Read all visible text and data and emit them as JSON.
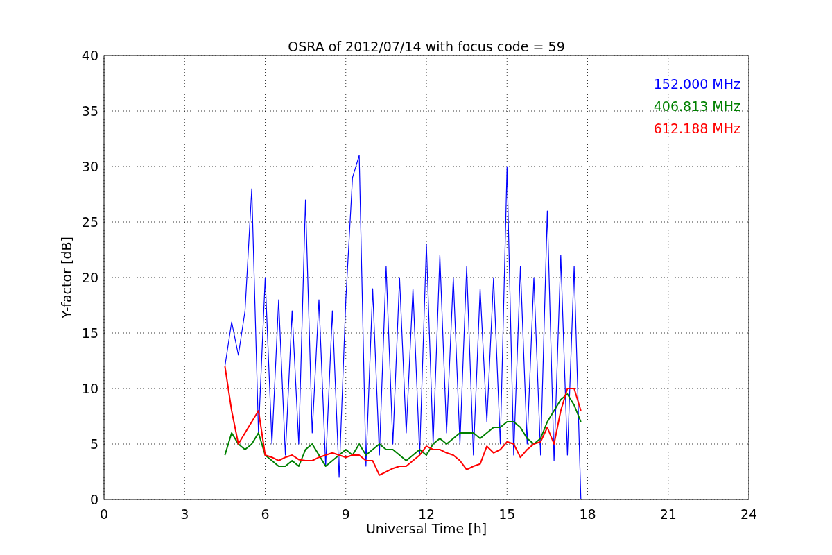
{
  "chart_data": {
    "type": "line",
    "title": "OSRA of 2012/07/14 with focus code = 59",
    "xlabel": "Universal Time [h]",
    "ylabel": "Y-factor [dB]",
    "xlim": [
      0,
      24
    ],
    "ylim": [
      0,
      40
    ],
    "xticks": [
      0,
      3,
      6,
      9,
      12,
      15,
      18,
      21,
      24
    ],
    "yticks": [
      0,
      5,
      10,
      15,
      20,
      25,
      30,
      35,
      40
    ],
    "grid": true,
    "x": [
      4.5,
      4.75,
      5,
      5.25,
      5.5,
      5.75,
      6,
      6.25,
      6.5,
      6.75,
      7,
      7.25,
      7.5,
      7.75,
      8,
      8.25,
      8.5,
      8.75,
      9,
      9.25,
      9.5,
      9.75,
      10,
      10.25,
      10.5,
      10.75,
      11,
      11.25,
      11.5,
      11.75,
      12,
      12.25,
      12.5,
      12.75,
      13,
      13.25,
      13.5,
      13.75,
      14,
      14.25,
      14.5,
      14.75,
      15,
      15.25,
      15.5,
      15.75,
      16,
      16.25,
      16.5,
      16.75,
      17,
      17.25,
      17.5,
      17.75
    ],
    "series": [
      {
        "name": "152.000 MHz",
        "color": "#0000ff",
        "values": [
          12,
          16,
          13,
          17,
          28,
          6,
          20,
          5,
          18,
          4,
          17,
          5,
          27,
          6,
          18,
          3,
          17,
          2,
          18,
          29,
          31,
          3,
          19,
          4,
          21,
          5,
          20,
          6,
          19,
          4,
          23,
          5,
          22,
          6,
          20,
          5,
          21,
          4,
          19,
          7,
          20,
          5,
          30,
          4,
          21,
          5,
          20,
          4,
          26,
          3.5,
          22,
          4,
          21,
          0
        ]
      },
      {
        "name": "406.813 MHz",
        "color": "#008000",
        "values": [
          4,
          6,
          5,
          4.5,
          5,
          6,
          4,
          3.5,
          3,
          3,
          3.5,
          3,
          4.5,
          5,
          4,
          3,
          3.5,
          4,
          4.5,
          4,
          5,
          4,
          4.5,
          5,
          4.5,
          4.5,
          4,
          3.5,
          4,
          4.5,
          4,
          5,
          5.5,
          5,
          5.5,
          6,
          6,
          6,
          5.5,
          6,
          6.5,
          6.5,
          7,
          7,
          6.5,
          5.5,
          5,
          5.5,
          7,
          8,
          9,
          9.5,
          8.5,
          7
        ]
      },
      {
        "name": "612.188 MHz",
        "color": "#ff0000",
        "values": [
          12,
          8,
          5,
          6,
          7,
          8,
          4,
          3.8,
          3.5,
          3.8,
          4,
          3.6,
          3.5,
          3.5,
          3.8,
          4,
          4.2,
          4,
          3.8,
          4,
          4,
          3.5,
          3.5,
          2.2,
          2.5,
          2.8,
          3,
          3,
          3.5,
          4,
          4.8,
          4.5,
          4.5,
          4.2,
          4,
          3.5,
          2.7,
          3,
          3.2,
          4.8,
          4.2,
          4.5,
          5.2,
          5,
          3.8,
          4.5,
          5,
          5.2,
          6.5,
          5,
          8,
          10,
          10,
          8
        ]
      }
    ]
  }
}
